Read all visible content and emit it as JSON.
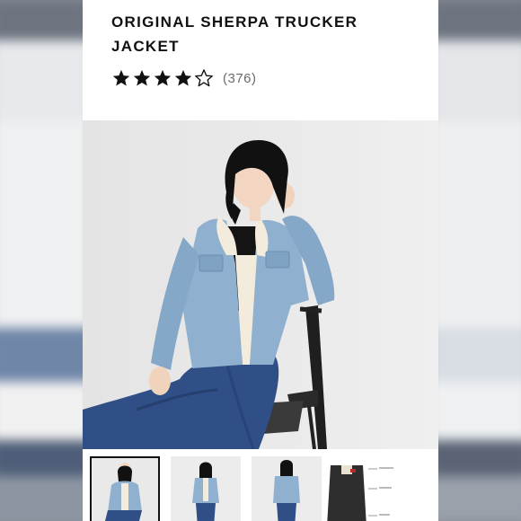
{
  "product": {
    "title": "ORIGINAL SHERPA TRUCKER JACKET",
    "rating_value": 4.5,
    "rating_max": 5,
    "review_count_label": "(376)"
  },
  "gallery": {
    "main_image": "woman-seated-in-sherpa-denim-jacket-photo",
    "thumbnails": [
      {
        "name": "seated-model-photo",
        "selected": true
      },
      {
        "name": "front-view-model-photo",
        "selected": false
      },
      {
        "name": "back-view-model-photo",
        "selected": false
      },
      {
        "name": "black-jacket-detail-photo",
        "selected": false
      }
    ]
  },
  "colors": {
    "text": "#111111",
    "muted": "#6b6b6b",
    "denim": "#8fb1cf",
    "jeans": "#2f4f86",
    "sherpa": "#f3ecdc",
    "photo_bg": "#eaeaea"
  }
}
